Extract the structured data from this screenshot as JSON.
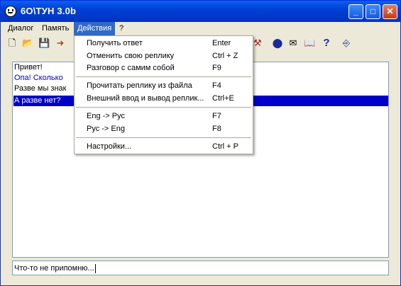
{
  "window": {
    "title": "6О\\ТУН 3.0b"
  },
  "titlebar_buttons": {
    "minimize": "_",
    "maximize": "□",
    "close": "✕"
  },
  "menubar": [
    {
      "label": "Диалог"
    },
    {
      "label": "Память"
    },
    {
      "label": "Действия",
      "active": true
    },
    {
      "label": "?"
    }
  ],
  "toolbar": {
    "icons": [
      "new-file-icon",
      "open-folder-icon",
      "save-icon",
      "export-icon",
      "tool-icon",
      "stop-icon",
      "mail-icon",
      "book-icon",
      "help-icon",
      "exit-icon"
    ],
    "glyphs": [
      "🗋",
      "📂",
      "💾",
      "➜",
      "⚒",
      "⬤",
      "✉",
      "📖",
      "?",
      "⎆"
    ]
  },
  "dialog_lines": [
    {
      "text": "Привет!",
      "style": "normal"
    },
    {
      "text": "Опа! Сколько",
      "style": "blue"
    },
    {
      "text": "Разве мы знак",
      "style": "normal"
    },
    {
      "text": "А разве нет?",
      "style": "selected"
    }
  ],
  "input": {
    "value": "Что-то не припомню..."
  },
  "dropdown": {
    "groups": [
      [
        {
          "label": "Получить ответ",
          "shortcut": "Enter"
        },
        {
          "label": "Отменить свою реплику",
          "shortcut": "Ctrl + Z"
        },
        {
          "label": "Разговор с самим собой",
          "shortcut": "F9"
        }
      ],
      [
        {
          "label": "Прочитать реплику из файла",
          "shortcut": "F4"
        },
        {
          "label": "Внешний ввод и вывод реплик...",
          "shortcut": "Ctrl+E"
        }
      ],
      [
        {
          "label": "Eng -> Рус",
          "shortcut": "F7"
        },
        {
          "label": "Рус -> Eng",
          "shortcut": "F8"
        }
      ],
      [
        {
          "label": "Настройки...",
          "shortcut": "Ctrl + P"
        }
      ]
    ]
  },
  "colors": {
    "titlebar": "#0040d6",
    "selection": "#0000c8",
    "menu_highlight": "#316ac5",
    "blue_text": "#0000c8"
  }
}
